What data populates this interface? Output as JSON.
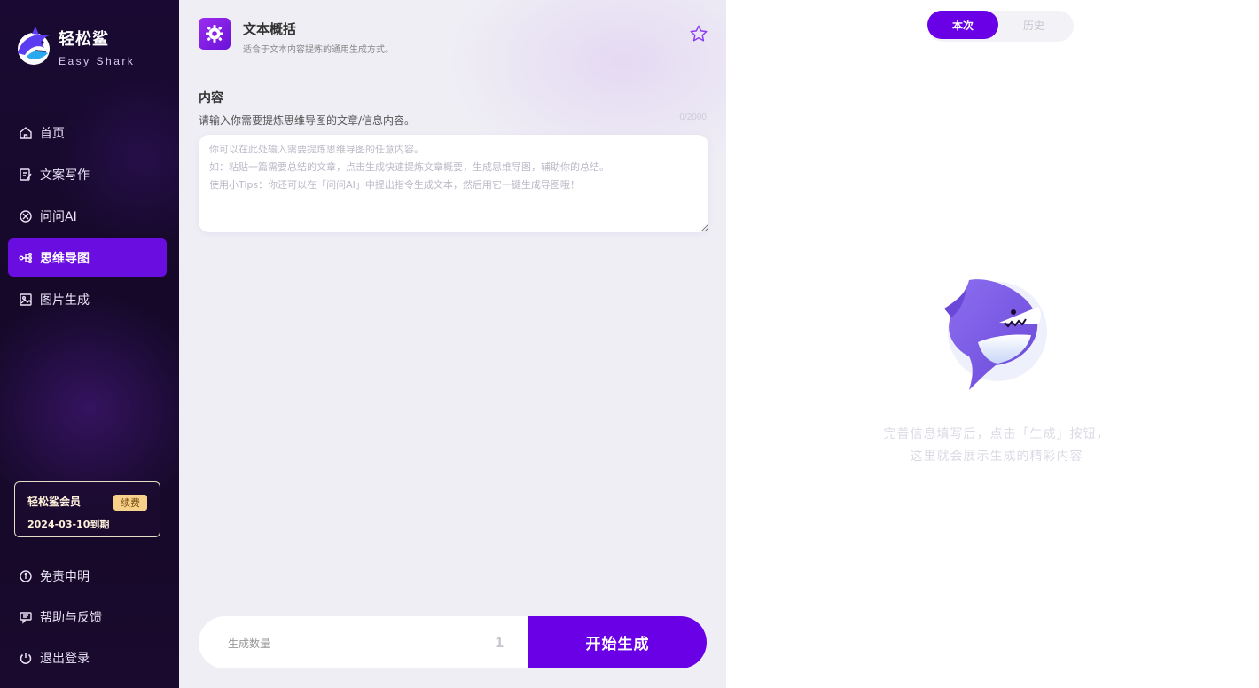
{
  "brand": {
    "name": "轻松鲨",
    "subtitle": "Easy Shark"
  },
  "nav": {
    "items": [
      {
        "label": "首页",
        "icon": "home-icon"
      },
      {
        "label": "文案写作",
        "icon": "edit-doc-icon"
      },
      {
        "label": "问问AI",
        "icon": "ai-chat-icon"
      },
      {
        "label": "思维导图",
        "icon": "mindmap-icon",
        "active": true
      },
      {
        "label": "图片生成",
        "icon": "image-icon"
      }
    ]
  },
  "member": {
    "title": "轻松鲨会员",
    "badge": "续费",
    "expiry": "2024-03-10到期"
  },
  "bottom_nav": {
    "items": [
      {
        "label": "免责申明",
        "icon": "info-icon"
      },
      {
        "label": "帮助与反馈",
        "icon": "feedback-icon"
      },
      {
        "label": "退出登录",
        "icon": "power-icon"
      }
    ]
  },
  "tool": {
    "title": "文本概括",
    "description": "适合于文本内容提炼的通用生成方式。"
  },
  "content": {
    "label": "内容",
    "hint": "请输入你需要提炼思维导图的文章/信息内容。",
    "count": "0/2000",
    "placeholder": "你可以在此处输入需要提炼思维导图的任意内容。\n如：粘贴一篇需要总结的文章，点击生成快速提炼文章概要，生成思维导图，辅助你的总结。\n使用小Tips：你还可以在「问问AI」中提出指令生成文本，然后用它一键生成导图哦！"
  },
  "generate": {
    "label": "生成数量",
    "quantity": "1",
    "button": "开始生成"
  },
  "tabs": {
    "current": "本次",
    "history": "历史"
  },
  "empty_state": {
    "line1": "完善信息填写后，点击「生成」按钮，",
    "line2": "这里就会展示生成的精彩内容"
  },
  "colors": {
    "accent": "#6a00e6",
    "sidebar_bg": "#1a0a33",
    "active_nav": "#6a0de0",
    "badge": "#f7d189"
  }
}
